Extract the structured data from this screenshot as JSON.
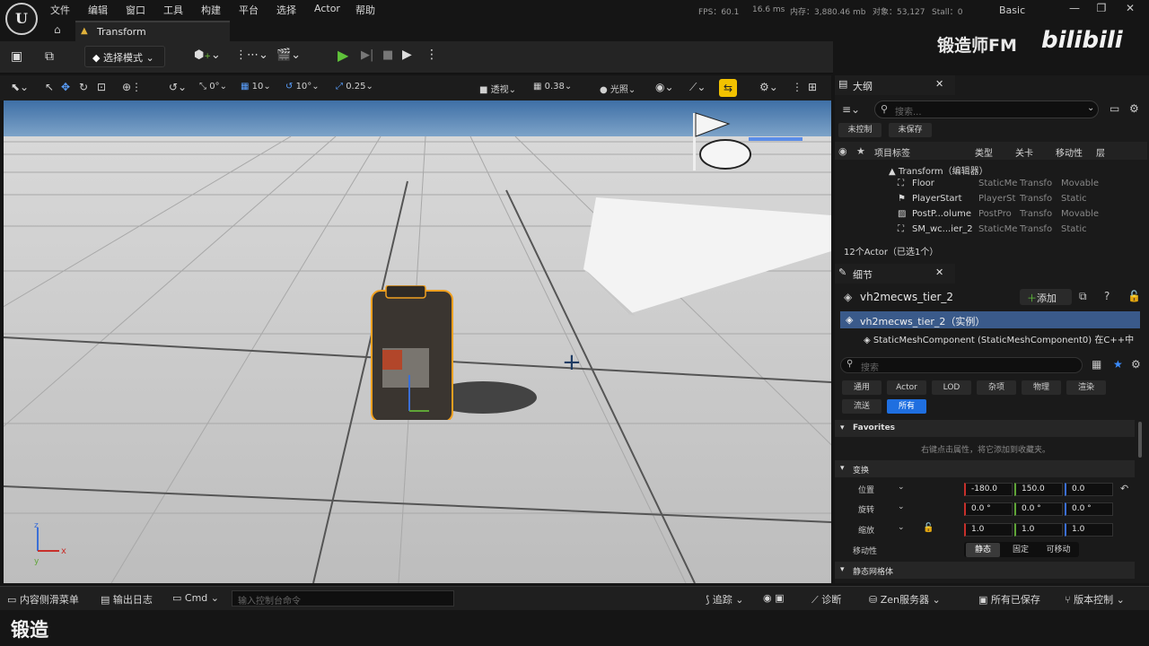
{
  "menu": {
    "items": [
      "文件",
      "编辑",
      "窗口",
      "工具",
      "构建",
      "平台",
      "选择",
      "Actor",
      "帮助"
    ]
  },
  "stats": {
    "fps": "FPS：60.1",
    "ms": "16.6 ms",
    "mem": "内存：3,880.46 mb",
    "objects": "对象：53,127",
    "stall": "Stall：0"
  },
  "layout_label": "Basic",
  "watermark": {
    "name": "锻造师FM",
    "brand": "bilibili"
  },
  "tab": {
    "title": "Transform"
  },
  "toolbar": {
    "mode": "选择模式"
  },
  "vp": {
    "rot_snap": "0°",
    "grid": "10",
    "angle": "10°",
    "scale": "0.25",
    "view": "透视",
    "camspeed": "0.38",
    "lit": "光照"
  },
  "outliner": {
    "title": "大纲",
    "search_ph": "搜索...",
    "btn_uncontrolled": "未控制",
    "btn_unsaved": "未保存",
    "cols": [
      "项目标签",
      "类型",
      "关卡",
      "移动性",
      "层"
    ],
    "root": "Transform（编辑器）",
    "rows": [
      {
        "name": "Floor",
        "type": "StaticMe",
        "level": "Transfo",
        "mob": "Movable"
      },
      {
        "name": "PlayerStart",
        "type": "PlayerSt",
        "level": "Transfo",
        "mob": "Static"
      },
      {
        "name": "PostP...olume",
        "type": "PostPro",
        "level": "Transfo",
        "mob": "Movable"
      },
      {
        "name": "SM_wc...ier_2",
        "type": "StaticMe",
        "level": "Transfo",
        "mob": "Static"
      }
    ],
    "footer": "12个Actor（已选1个）"
  },
  "details": {
    "title": "细节",
    "actor": "vh2mecws_tier_2",
    "add": "添加",
    "instance": "vh2mecws_tier_2（实例）",
    "component": "StaticMeshComponent (StaticMeshComponent0)  在C++中",
    "search_ph": "搜索",
    "filters": [
      "通用",
      "Actor",
      "LOD",
      "杂项",
      "物理",
      "渲染",
      "流送",
      "所有"
    ],
    "favorites": "Favorites",
    "fav_hint": "右键点击属性，将它添加到收藏夹。",
    "transform": "变换",
    "loc_label": "位置",
    "rot_label": "旋转",
    "scale_label": "缩放",
    "loc": [
      "-180.0",
      "150.0",
      "0.0"
    ],
    "rot": [
      "0.0 °",
      "0.0 °",
      "0.0 °"
    ],
    "scl": [
      "1.0",
      "1.0",
      "1.0"
    ],
    "mobility": "移动性",
    "mob_opts": [
      "静态",
      "固定",
      "可移动"
    ],
    "staticmesh": "静态网格体"
  },
  "status": {
    "drawer": "内容侧滑菜单",
    "log": "输出日志",
    "cmd": "Cmd",
    "cmd_ph": "输入控制台命令",
    "trace": "追踪",
    "diag": "诊断",
    "zen": "Zen服务器",
    "saved": "所有已保存",
    "vc": "版本控制"
  },
  "caption": "锻造"
}
